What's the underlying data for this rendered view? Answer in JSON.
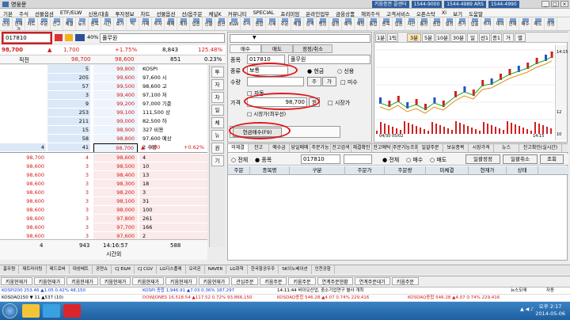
{
  "window": {
    "title": "영웅문",
    "broker": "키움증권 콜센터",
    "phones": [
      "1544-9000",
      "1544-4989 ARS",
      "1544-4990"
    ]
  },
  "menu": [
    "기본",
    "주식",
    "선물옵션",
    "ETF/ELW",
    "신용/대출",
    "투자정보",
    "차트",
    "선물옵션",
    "선/옵주문",
    "채널K",
    "커뮤니티",
    "SPECIAL",
    "프리미엄",
    "온라인업무",
    "금융상품",
    "해외주식",
    "고객서비스",
    "오픈스탁",
    "Xi",
    "보기",
    "도움말"
  ],
  "toolbar": [
    "관심",
    "현재가",
    "차트",
    "주문",
    "잔고",
    "체결",
    "뉴스",
    "종목",
    "시간",
    "호가",
    "틱",
    "거래",
    "투자",
    "매매",
    "계좌",
    "업종",
    "선물",
    "옵션",
    "ELW",
    "주식",
    "종합",
    "시세",
    "주문",
    "체결",
    "검색",
    "랭킹",
    "설정",
    "예약",
    "채팅",
    "통합",
    "종목",
    "업종",
    "자산",
    "통장",
    "종합",
    "설정",
    "증거",
    "입출",
    "투자",
    "대여",
    "현재",
    "매수",
    "매도",
    "정정",
    "취소",
    "기업",
    "HTS"
  ],
  "left": {
    "code": "017810",
    "name": "풀무원",
    "rate_label": "40%",
    "quote": {
      "price": "98,700",
      "arrow": "▲",
      "change": "1,700",
      "pct": "+1.75%",
      "volume": "8,843",
      "ratio": "125.48%"
    },
    "quote2": {
      "label": "직전",
      "price": "98,700",
      "high": "98,600",
      "v1": "851",
      "v2": "0.23%"
    },
    "sell_rows": [
      {
        "a": "",
        "b": "5",
        "p": "99,800"
      },
      {
        "a": "",
        "b": "205",
        "p": "99,600"
      },
      {
        "a": "",
        "b": "57",
        "p": "99,500"
      },
      {
        "a": "",
        "b": "3",
        "p": "99,400"
      },
      {
        "a": "",
        "b": "9",
        "p": "99,200"
      },
      {
        "a": "",
        "b": "253",
        "p": "99,100"
      },
      {
        "a": "",
        "b": "211",
        "p": "99,000"
      },
      {
        "a": "",
        "b": "15",
        "p": "98,900"
      },
      {
        "a": "",
        "b": "58",
        "p": "98,800"
      },
      {
        "a": "4",
        "b": "41",
        "p": "98,700"
      }
    ],
    "side_info": [
      "KOSPI",
      "97,600 시",
      "98,600 고",
      "97,100 저",
      "97,000 기준",
      "111,500 상",
      "82,500 하",
      "327 비용",
      "97,600 예상",
      "2 수량"
    ],
    "side_foot": {
      "arrow": "▲",
      "v": "600",
      "pct": "+0.62%"
    },
    "buy_rows": [
      {
        "a": "98,700",
        "b": "4",
        "p": "98,600",
        "q": "4"
      },
      {
        "a": "98,600",
        "b": "3",
        "p": "98,500",
        "q": "10"
      },
      {
        "a": "98,600",
        "b": "3",
        "p": "98,400",
        "q": "13"
      },
      {
        "a": "98,600",
        "b": "3",
        "p": "98,300",
        "q": "18"
      },
      {
        "a": "98,600",
        "b": "3",
        "p": "98,200",
        "q": "3"
      },
      {
        "a": "98,600",
        "b": "3",
        "p": "98,100",
        "q": "31"
      },
      {
        "a": "98,600",
        "b": "3",
        "p": "98,000",
        "q": "100"
      },
      {
        "a": "98,600",
        "b": "3",
        "p": "97,800",
        "q": "261"
      },
      {
        "a": "98,600",
        "b": "3",
        "p": "97,700",
        "q": "166"
      },
      {
        "a": "98,600",
        "b": "3",
        "p": "97,600",
        "q": "2"
      }
    ],
    "foot": {
      "a": "4",
      "b": "943",
      "time": "14:16:57",
      "time_label": "시간외",
      "total": "588"
    },
    "vtabs": [
      "투",
      "자",
      "차",
      "일",
      "체",
      "뉴",
      "권",
      "기"
    ]
  },
  "order": {
    "tabs": [
      "매수",
      "매도",
      "정정/취소"
    ],
    "code_label": "종목",
    "code": "017810",
    "name": "풀무원",
    "type_label": "종류",
    "type_value": "보통",
    "radios": [
      "현금",
      "신용"
    ],
    "qty_label": "수량",
    "qty_btns": [
      "주",
      "가"
    ],
    "qty_check": "미수",
    "checks": [
      "자동"
    ],
    "price_label": "가격",
    "price": "98,700",
    "won": "원",
    "market_check": "시장가",
    "sub_check": "시장가(최우선)",
    "submit": "현금매수(F9)"
  },
  "chart": {
    "tabs": [
      "1분",
      "1틱",
      "3분",
      "5분",
      "10분",
      "30분",
      "일",
      "선1",
      "종1",
      "거",
      "별"
    ],
    "active": "3분",
    "labels": [
      "14:15",
      "04/30 05/02",
      "14:15",
      "12",
      "10"
    ]
  },
  "lower": {
    "tabs": [
      "미체결",
      "잔고",
      "예수금",
      "당일매매",
      "주문가능",
      "잔고검색",
      "체결확인",
      "잔고예탁",
      "주문가능조회",
      "일괄주문",
      "보유종목",
      "시장가격",
      "뉴스",
      "잔고확인(실시간)"
    ],
    "filter": {
      "all": "전체",
      "stock": "종목",
      "code": "017810",
      "all2": "전체",
      "buy": "매수",
      "sell": "매도",
      "btn1": "일괄정정",
      "btn2": "일괄취소",
      "btn3": "조회"
    },
    "headers": [
      "주문",
      "종목명",
      "구분",
      "주문가",
      "주문량",
      "미체결",
      "현재가",
      "상태"
    ]
  },
  "stockbar": [
    "홈무원",
    "제트라이팅",
    "레드로버",
    "대성베트",
    "공연쇼",
    "CJ E&M",
    "CJ CGV",
    "LG디스플레",
    "오리온",
    "NAVER",
    "LG화학",
    "한국항공우주",
    "SK이노베이션",
    "인천공항"
  ],
  "wintabs": [
    "키움현재가",
    "키움현재가",
    "키움현재가",
    "키움현재가",
    "키움현재가",
    "키움현재가",
    "키움현재가",
    "관심주문",
    "키움주문",
    "키움주문",
    "연계주문현황",
    "연계주문대기",
    "키움주문"
  ],
  "ticker1": {
    "a": "KOSPI200 253.46 ▲1.05 0.42% 48,150",
    "b": "KOSPI 종합 1,946.91 ▲7.03 0.36% 187,297",
    "c": "14:11:44 바이오산업, 중소기업연구 별사 개최",
    "d": "뉴스도매",
    "e": "자동"
  },
  "ticker2": {
    "a": "KOSDAQ150 ▼ 11 ▲537 (10)",
    "b": "DOWJONES 16,518.54 ▲117.52 0.72% 93,866,150",
    "c": "KOSDAQ종합 546.28 ▲4.07 0.74% 229,416",
    "d": "KOSDAQ종합 546.28 ▲4.07 0.74% 229,416"
  },
  "clock": {
    "time": "오후 2:17",
    "date": "2014-05-06"
  },
  "tray": "▲ ◀ ♪"
}
